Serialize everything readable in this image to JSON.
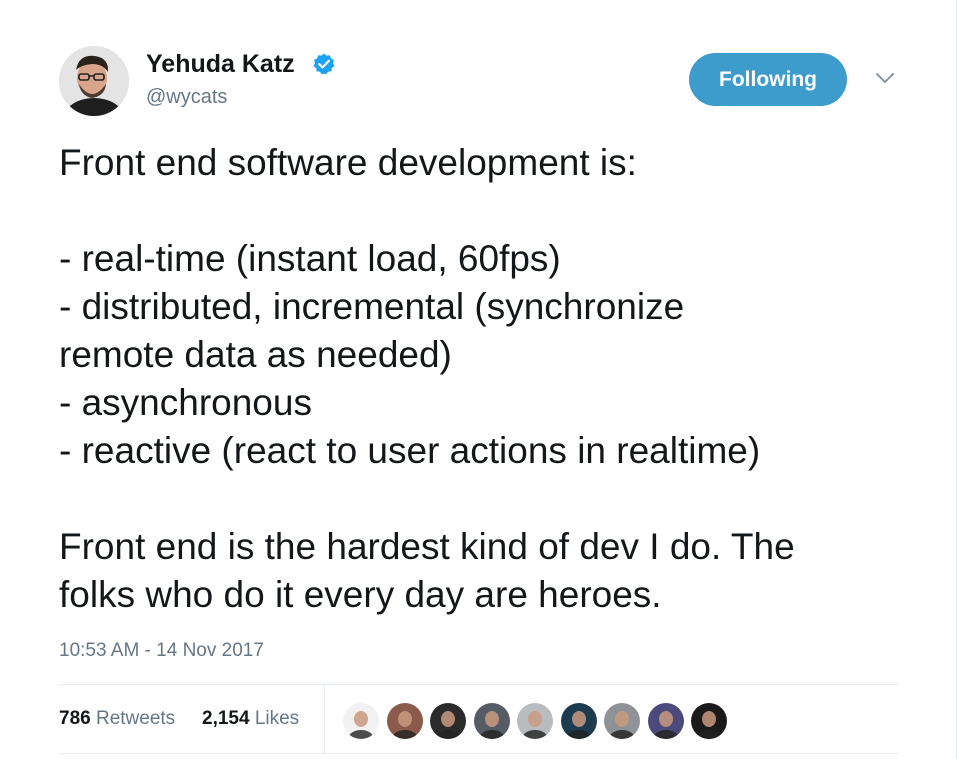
{
  "author": {
    "name": "Yehuda Katz",
    "handle": "@wycats",
    "verified": true,
    "avatar_icon": "avatar-photo"
  },
  "follow_button": {
    "label": "Following",
    "color": "#3d9ccb"
  },
  "menu_icon": "chevron-down-icon",
  "tweet": {
    "lines": [
      "Front end software development is:",
      "",
      "- real-time (instant load, 60fps)",
      "- distributed, incremental (synchronize",
      "remote data as needed)",
      "- asynchronous",
      "- reactive (react to user actions in realtime)",
      "",
      "Front end is the hardest kind of dev I do. The",
      "folks who do it every day are heroes."
    ]
  },
  "timestamp": "10:53 AM - 14 Nov 2017",
  "stats": {
    "retweets_count": "786",
    "retweets_label": "Retweets",
    "likes_count": "2,154",
    "likes_label": "Likes"
  },
  "likers": [
    {
      "icon": "liker-avatar",
      "color": "#f2f2f2"
    },
    {
      "icon": "liker-avatar",
      "color": "#8a5a4a"
    },
    {
      "icon": "liker-avatar",
      "color": "#2b2b2b"
    },
    {
      "icon": "liker-avatar",
      "color": "#555c66"
    },
    {
      "icon": "liker-avatar",
      "color": "#b9bcbf"
    },
    {
      "icon": "liker-avatar",
      "color": "#1d3b4f"
    },
    {
      "icon": "liker-avatar",
      "color": "#8f9296"
    },
    {
      "icon": "liker-avatar",
      "color": "#4b4a7a"
    },
    {
      "icon": "liker-avatar",
      "color": "#1a1a1a"
    }
  ],
  "colors": {
    "text": "#14171a",
    "secondary": "#657786",
    "verified": "#1da1f2",
    "divider": "#e6ecf0"
  }
}
